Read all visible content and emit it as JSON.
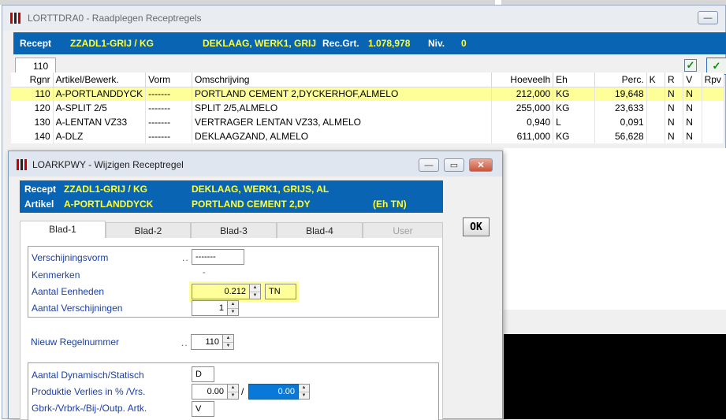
{
  "main": {
    "title": "LORTTDRA0 - Raadplegen Receptregels",
    "header": {
      "recept_label": "Recept",
      "recept_value": "ZZADL1-GRIJ / KG",
      "description": "DEKLAAG, WERK1, GRIJ",
      "recgrt_label": "Rec.Grt.",
      "recgrt_value": "1.078,978",
      "niv_label": "Niv.",
      "niv_value": "0"
    },
    "search_value": "110",
    "columns": [
      "Rgnr",
      "Artikel/Bewerk.",
      "Vorm",
      "Omschrijving",
      "Hoeveelh",
      "Eh",
      "Perc.",
      "K",
      "R",
      "V",
      "Rpv"
    ],
    "rows": [
      {
        "rgnr": "110",
        "artikel": "A-PORTLANDDYCK",
        "vorm": "-------",
        "omschrijving": "PORTLAND CEMENT 2,DYCKERHOF,ALMELO",
        "hoeveelh": "212,000",
        "eh": "KG",
        "perc": "19,648",
        "k": "",
        "r": "N",
        "v": "N"
      },
      {
        "rgnr": "120",
        "artikel": "A-SPLIT 2/5",
        "vorm": "-------",
        "omschrijving": "SPLIT 2/5,ALMELO",
        "hoeveelh": "255,000",
        "eh": "KG",
        "perc": "23,633",
        "k": "",
        "r": "N",
        "v": "N"
      },
      {
        "rgnr": "130",
        "artikel": "A-LENTAN VZ33",
        "vorm": "-------",
        "omschrijving": "VERTRAGER LENTAN VZ33, ALMELO",
        "hoeveelh": "0,940",
        "eh": "L",
        "perc": "0,091",
        "k": "",
        "r": "N",
        "v": "N"
      },
      {
        "rgnr": "140",
        "artikel": "A-DLZ",
        "vorm": "-------",
        "omschrijving": "DEKLAAGZAND, ALMELO",
        "hoeveelh": "611,000",
        "eh": "KG",
        "perc": "56,628",
        "k": "",
        "r": "N",
        "v": "N"
      }
    ]
  },
  "dialog": {
    "title": "LOARKPWY - Wijzigen Receptregel",
    "recept_label": "Recept",
    "recept_value": "ZZADL1-GRIJ / KG",
    "recept_desc": "DEKLAAG, WERK1, GRIJS, AL",
    "artikel_label": "Artikel",
    "artikel_value": "A-PORTLANDDYCK",
    "artikel_desc": "PORTLAND CEMENT 2,DY",
    "artikel_unit": "(Eh TN)",
    "tabs": [
      "Blad-1",
      "Blad-2",
      "Blad-3",
      "Blad-4",
      "User"
    ],
    "ok_label": "OK",
    "verschijningsvorm_label": "Verschijningsvorm",
    "verschijningsvorm_dots": "..",
    "verschijningsvorm_value": "-------",
    "kenmerken_label": "Kenmerken",
    "kenmerken_value": "-",
    "aantal_eenheden_label": "Aantal Eenheden",
    "aantal_eenheden_value": "0.212",
    "aantal_eenheden_unit": "TN",
    "aantal_verschijningen_label": "Aantal Verschijningen",
    "aantal_verschijningen_value": "1",
    "nieuw_regelnummer_label": "Nieuw Regelnummer",
    "nieuw_regelnummer_dots": "..",
    "nieuw_regelnummer_value": "110",
    "dyn_stat_label": "Aantal Dynamisch/Statisch",
    "dyn_stat_value": "D",
    "verlies_label": "Produktie Verlies in % /Vrs.",
    "verlies_pct": "0.00",
    "verlies_sep": "/",
    "verlies_vrs": "0.00",
    "gbrk_label": "Gbrk-/Vrbrk-/Bij-/Outp. Artk.",
    "gbrk_value": "V"
  },
  "colors": {
    "header_blue": "#0a64b4",
    "highlight_yellow": "#ffff99",
    "label_blue": "#1c3fa3"
  }
}
